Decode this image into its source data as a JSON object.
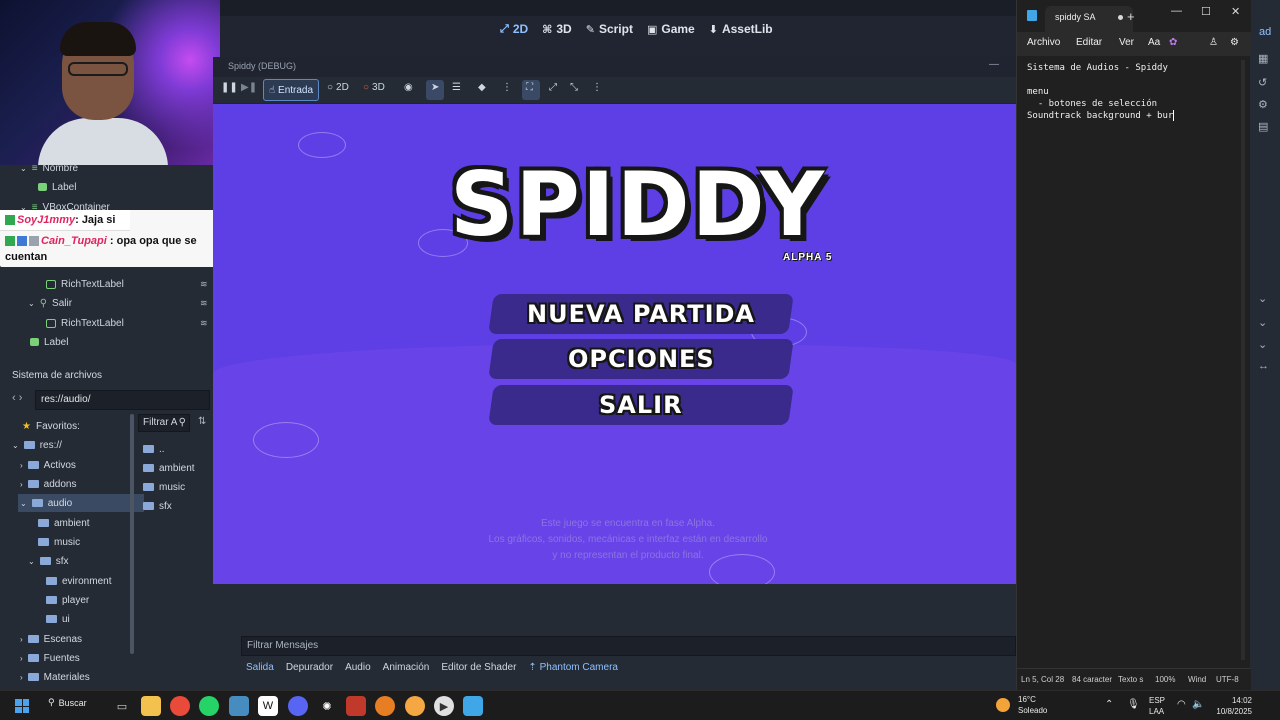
{
  "godot": {
    "workspace_tabs": [
      {
        "label": "2D",
        "icon": "2d-icon",
        "active": true
      },
      {
        "label": "3D",
        "icon": "3d-icon",
        "active": false
      },
      {
        "label": "Script",
        "icon": "script-icon",
        "active": false
      },
      {
        "label": "Game",
        "icon": "game-icon",
        "active": false
      },
      {
        "label": "AssetLib",
        "icon": "assetlib-icon",
        "active": false
      }
    ],
    "right_text": "ad"
  },
  "scene_tree": {
    "rows": [
      "Nombre",
      "Label",
      "VBoxContainer",
      "RichTextLabel",
      "Salir",
      "RichTextLabel",
      "Label"
    ]
  },
  "chat": {
    "messages": [
      {
        "user": "SoyJ1mmy",
        "text": ": Jaja si"
      },
      {
        "user": "Cain_Tupapi",
        "text": ": opa opa que se cuentan"
      }
    ]
  },
  "filesystem": {
    "title": "Sistema de archivos",
    "path": "res://audio/",
    "favorites": "Favoritos:",
    "tree": [
      "res://",
      "Activos",
      "addons",
      "audio",
      "ambient",
      "music",
      "sfx",
      "evironment",
      "player",
      "ui",
      "Escenas",
      "Fuentes",
      "Materiales"
    ],
    "filter_placeholder": "Filtrar A",
    "files": [
      "..",
      "ambient",
      "music",
      "sfx"
    ]
  },
  "game_window": {
    "title": "Spiddy (DEBUG)",
    "toolbar": {
      "entrada": "Entrada",
      "mode_2d": "2D",
      "mode_3d": "3D"
    },
    "logo": "SPIDDY",
    "alpha": "ALPHA 5",
    "menu": [
      "NUEVA PARTIDA",
      "OPCIONES",
      "SALIR"
    ],
    "disclaimer": [
      "Este juego se encuentra en fase Alpha.",
      "Los gráficos, sonidos, mecánicas e interfaz están en desarrollo",
      "y no representan el producto final."
    ],
    "colors": {
      "background": "#5e3fe6",
      "button": "#3a2a8c"
    }
  },
  "bottom_panel": {
    "filter_placeholder": "Filtrar Mensajes",
    "tabs": [
      "Salida",
      "Depurador",
      "Audio",
      "Animación",
      "Editor de Shader",
      "Phantom Camera"
    ]
  },
  "notepad": {
    "tab_title": "spiddy SA",
    "menu": [
      "Archivo",
      "Editar",
      "Ver"
    ],
    "lines": [
      "Sistema de Audios - Spiddy",
      "",
      "menu",
      "  - botones de selección",
      "Soundtrack background + bur"
    ],
    "status": {
      "position": "Ln 5, Col 28",
      "chars": "84 caracter",
      "format": "Texto s",
      "zoom": "100%",
      "eol": "Wind",
      "encoding": "UTF-8"
    }
  },
  "taskbar": {
    "search": "Buscar",
    "weather_temp": "16°C",
    "weather_desc": "Soleado",
    "lang_line1": "ESP",
    "lang_line2": "LAA",
    "time": "14:02",
    "date": "10/8/2025"
  }
}
